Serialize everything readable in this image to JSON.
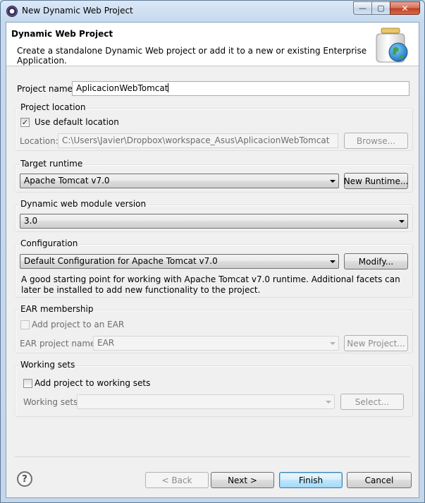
{
  "window": {
    "title": "New Dynamic Web Project",
    "close_glyph": "✕",
    "minimize_glyph": "—",
    "maximize_glyph": "▢"
  },
  "header": {
    "title": "Dynamic Web Project",
    "description": "Create a standalone Dynamic Web project or add it to a new or existing Enterprise Application."
  },
  "project_name": {
    "label": "Project name:",
    "value": "AplicacionWebTomcat"
  },
  "project_location": {
    "group_title": "Project location",
    "use_default_label": "Use default location",
    "use_default_checked": true,
    "location_label": "Location:",
    "location_value": "C:\\Users\\Javier\\Dropbox\\workspace_Asus\\AplicacionWebTomcat",
    "browse_label": "Browse..."
  },
  "target_runtime": {
    "group_title": "Target runtime",
    "selected": "Apache Tomcat v7.0",
    "new_runtime_label": "New Runtime..."
  },
  "module_version": {
    "group_title": "Dynamic web module version",
    "selected": "3.0"
  },
  "configuration": {
    "group_title": "Configuration",
    "selected": "Default Configuration for Apache Tomcat v7.0",
    "modify_label": "Modify...",
    "description": "A good starting point for working with Apache Tomcat v7.0 runtime. Additional facets can later be installed to add new functionality to the project."
  },
  "ear": {
    "group_title": "EAR membership",
    "add_label": "Add project to an EAR",
    "add_checked": false,
    "name_label": "EAR project name:",
    "name_value": "EAR",
    "new_project_label": "New Project..."
  },
  "working_sets": {
    "group_title": "Working sets",
    "add_label": "Add project to working sets",
    "add_checked": false,
    "sets_label": "Working sets:",
    "sets_value": "",
    "select_label": "Select..."
  },
  "footer": {
    "help_glyph": "?",
    "back_label": "< Back",
    "next_label": "Next >",
    "finish_label": "Finish",
    "cancel_label": "Cancel"
  },
  "icons": {
    "header_icon": "jar-globe-icon",
    "check_glyph": "✓"
  },
  "colors": {
    "title_bar": "#c6d9ee",
    "close_button": "#c0401f",
    "default_button_border": "#3c7fb1"
  }
}
